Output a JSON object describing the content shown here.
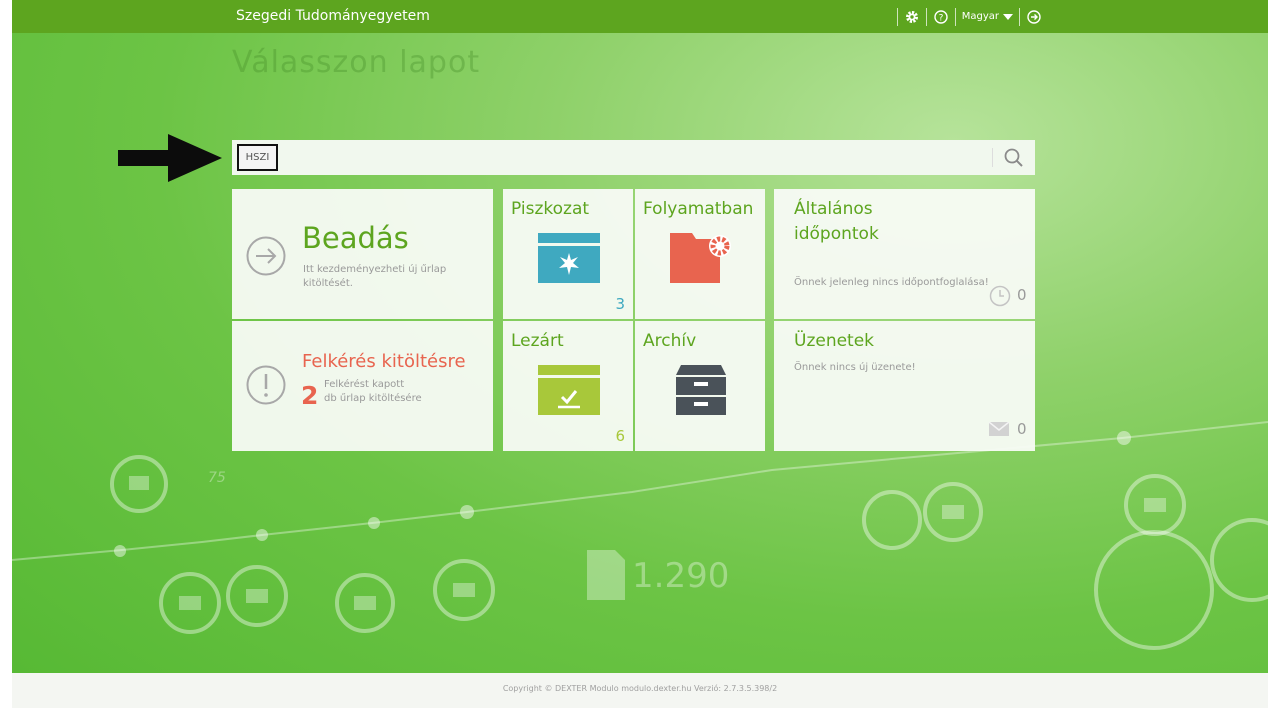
{
  "header": {
    "brand": "Szegedi Tudományegyetem",
    "language": "Magyar",
    "icons": [
      "gear-icon",
      "help-icon",
      "logout-icon"
    ]
  },
  "background": {
    "ghost_title": "Válasszon lapot",
    "big_number": "1.290",
    "axis_number": "75"
  },
  "search": {
    "value": "HSZI"
  },
  "tiles": {
    "beadas": {
      "title": "Beadás",
      "desc": "Itt kezdeményezheti új űrlap kitöltését."
    },
    "piszkozat": {
      "title": "Piszkozat",
      "count": "3"
    },
    "folyamatban": {
      "title": "Folyamatban"
    },
    "idopontok": {
      "title_line1": "Általános",
      "title_line2": "időpontok",
      "desc": "Önnek jelenleg nincs időpontfoglalása!",
      "count": "0"
    },
    "felkeres": {
      "title": "Felkérés kitöltésre",
      "number": "2",
      "desc_line1": "Felkérést kapott",
      "desc_line2": "db űrlap kitöltésére"
    },
    "lezart": {
      "title": "Lezárt",
      "count": "6"
    },
    "archiv": {
      "title": "Archív"
    },
    "uzenetek": {
      "title": "Üzenetek",
      "desc": "Önnek nincs új üzenete!",
      "count": "0"
    }
  },
  "footer": {
    "copyright": "Copyright © DEXTER Modulo modulo.dexter.hu Verzió: 2.7.3.5.398/2"
  },
  "colors": {
    "topbar": "#5da51f",
    "tile_green": "#5da51f",
    "accent_teal": "#3fa9c0",
    "accent_red": "#e8644f",
    "accent_lime": "#a8c83a",
    "archive_gray": "#4a5259"
  }
}
